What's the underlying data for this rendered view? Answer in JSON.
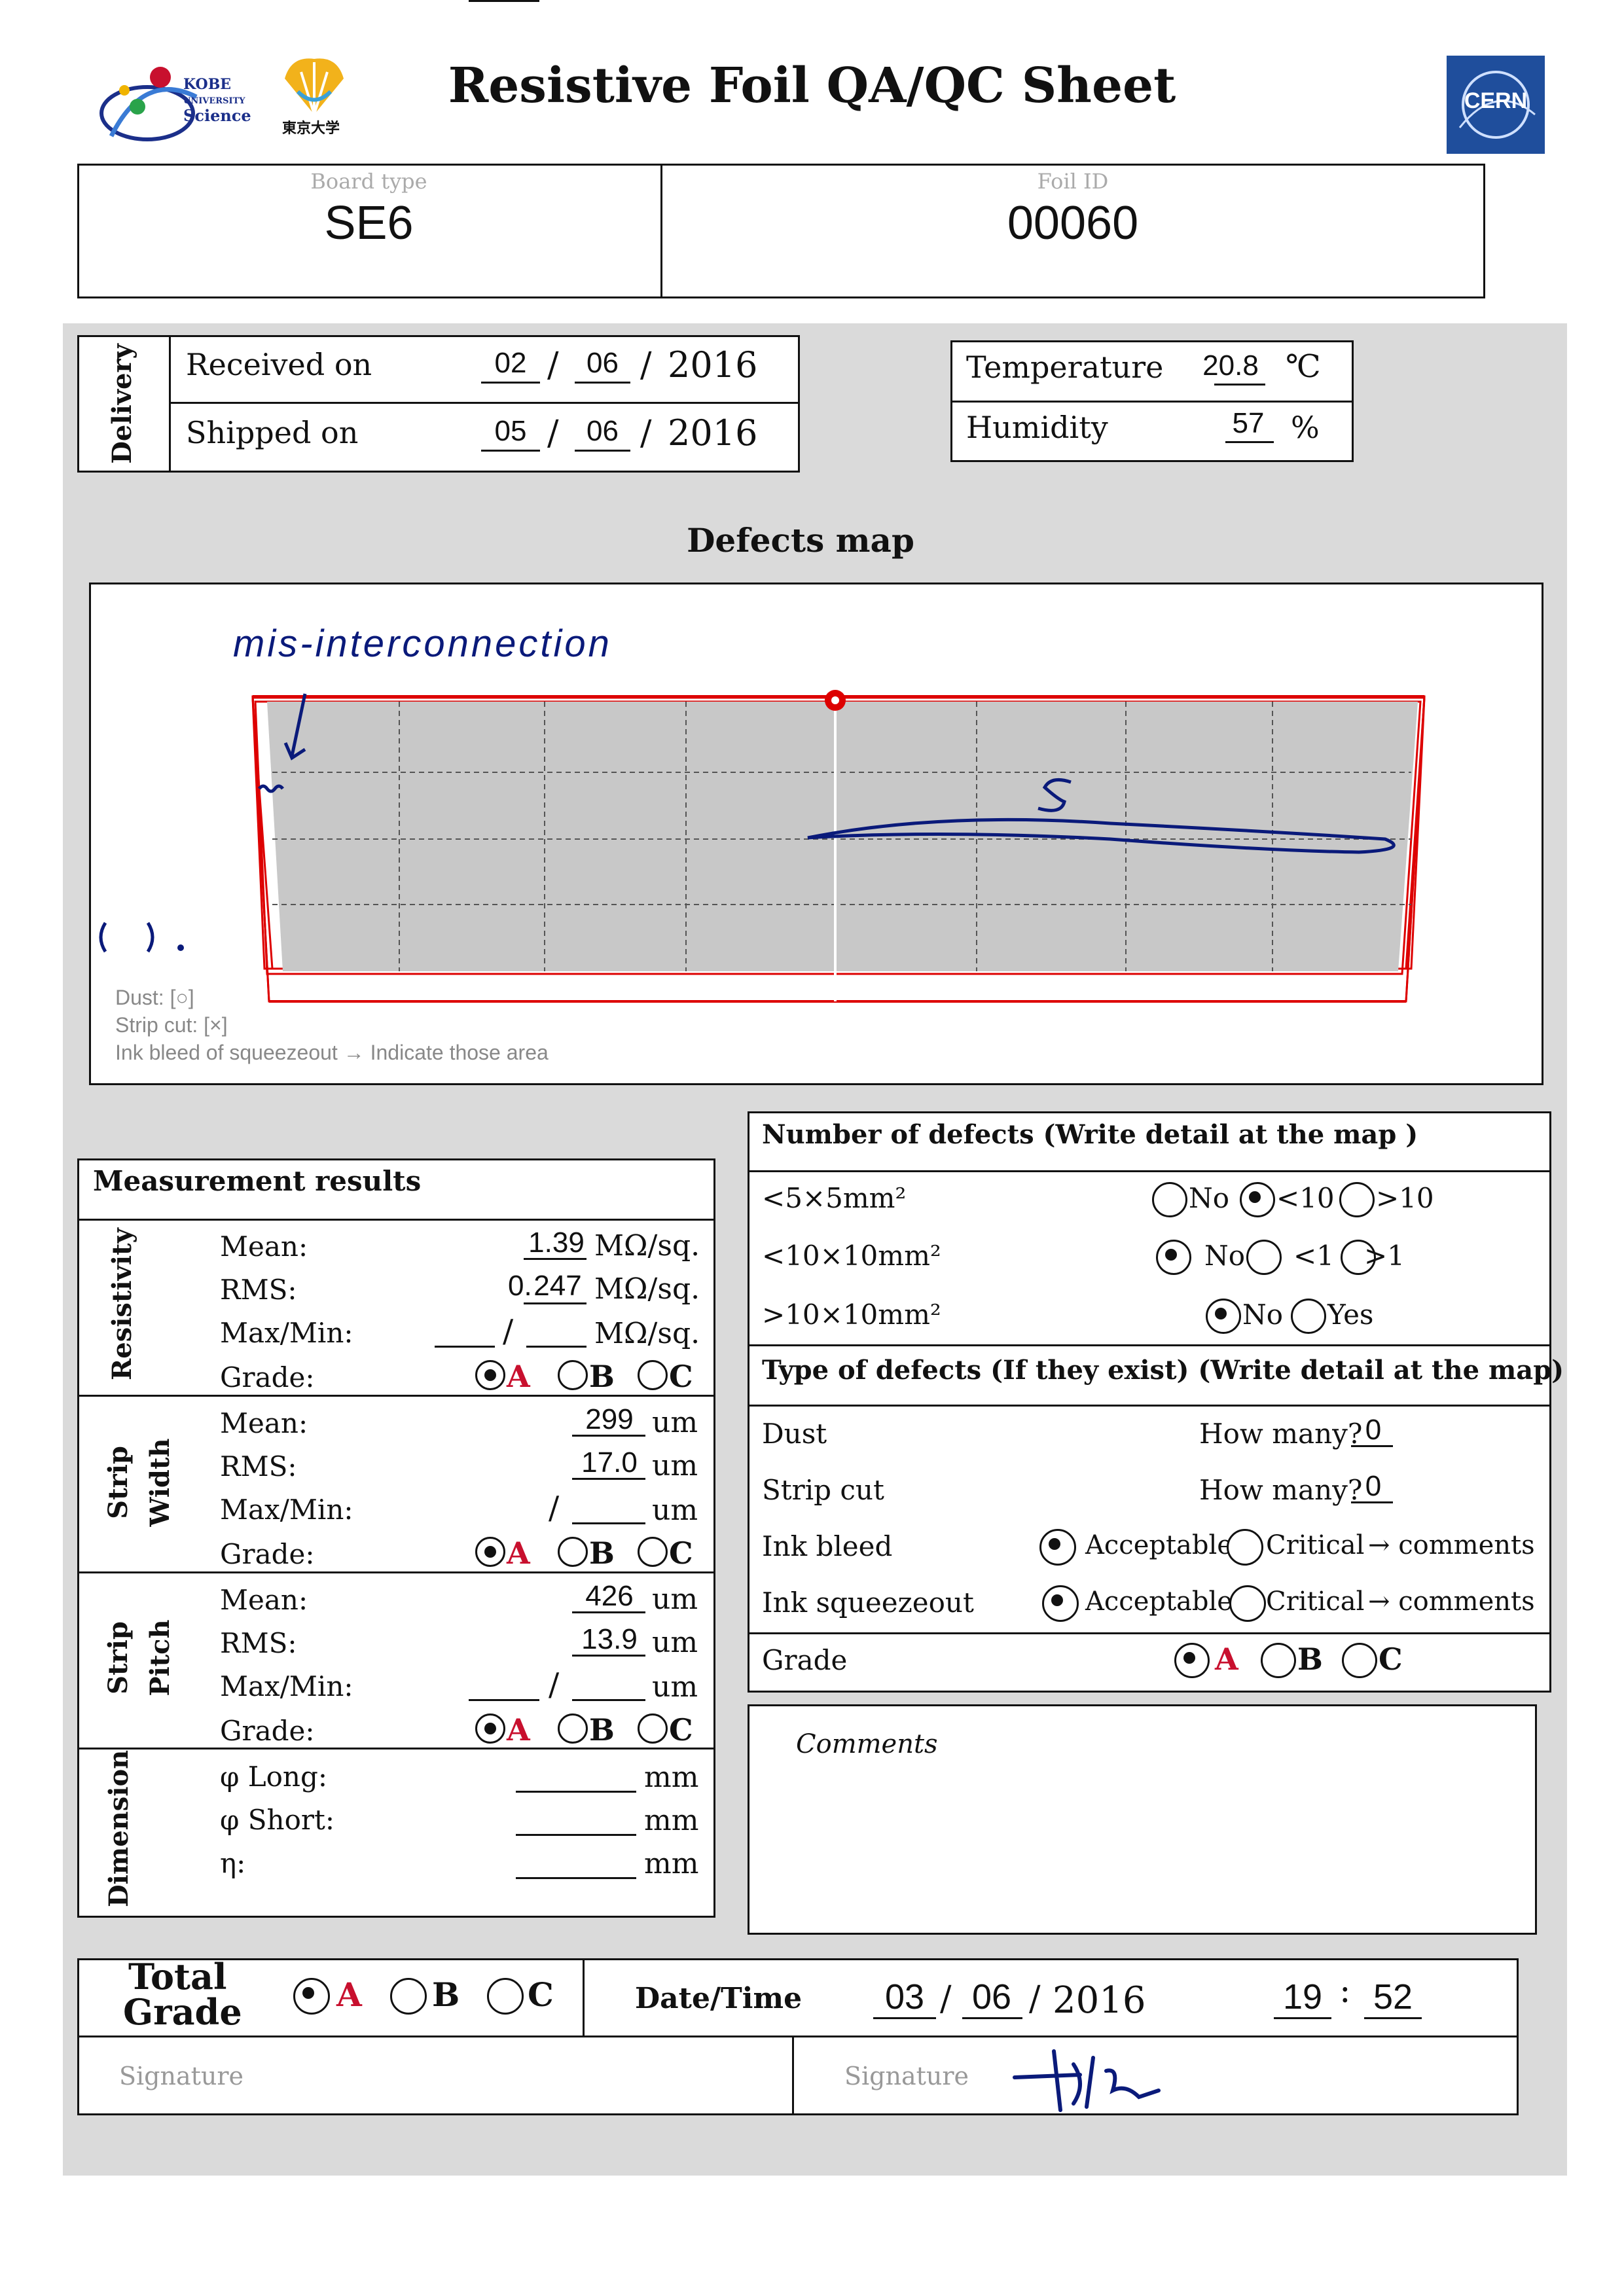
{
  "header": {
    "title": "Resistive Foil QA/QC Sheet",
    "kobe_logo": {
      "line1": "KOBE",
      "line2": "UNIVERSITY",
      "line3": "Science"
    },
    "tokyo_logo": {
      "text": "東京大学"
    },
    "cern_logo": {
      "text": "CERN"
    }
  },
  "ids": {
    "board_type_label": "Board type",
    "board_type_value": "SE6",
    "foil_id_label": "Foil ID",
    "foil_id_value": "00060"
  },
  "delivery": {
    "section_label": "Delivery",
    "received_label": "Received on",
    "received_day": "02",
    "received_month": "06",
    "received_year": "2016",
    "shipped_label": "Shipped on",
    "shipped_day": "05",
    "shipped_month": "06",
    "shipped_year": "2016",
    "slash": "/"
  },
  "environment": {
    "temperature_label": "Temperature",
    "temperature_value": "20.8",
    "temperature_unit": "℃",
    "humidity_label": "Humidity",
    "humidity_value": "57",
    "humidity_unit": "%"
  },
  "defects_map": {
    "title": "Defects map",
    "legend_dust": "Dust: [○]",
    "legend_strip_cut": "Strip cut: [×]",
    "legend_ink": "Ink bleed of squeezeout  →  Indicate those area",
    "annotation_misconnection": "mis-interconnection",
    "annotation_s": "S",
    "annotation_circle": "( ) ."
  },
  "measurement": {
    "title": "Measurement results",
    "resistivity": {
      "label": "Resistivity",
      "mean_label": "Mean:",
      "mean_value": "1.39",
      "mean_unit": "MΩ/sq.",
      "rms_label": "RMS:",
      "rms_prefix": "0.",
      "rms_value": "247",
      "rms_unit": "MΩ/sq.",
      "maxmin_label": "Max/Min:",
      "maxmin_unit": "MΩ/sq.",
      "grade_label": "Grade:",
      "grade_selected": "A"
    },
    "strip_width": {
      "label1": "Strip",
      "label2": "Width",
      "mean_label": "Mean:",
      "mean_value": "299",
      "mean_unit": "um",
      "rms_label": "RMS:",
      "rms_value": "17.0",
      "rms_unit": "um",
      "maxmin_label": "Max/Min:",
      "maxmin_unit": "um",
      "grade_label": "Grade:",
      "grade_selected": "A"
    },
    "strip_pitch": {
      "label1": "Strip",
      "label2": "Pitch",
      "mean_label": "Mean:",
      "mean_value": "426",
      "mean_unit": "um",
      "rms_label": "RMS:",
      "rms_value": "13.9",
      "rms_unit": "um",
      "maxmin_label": "Max/Min:",
      "maxmin_unit": "um",
      "grade_label": "Grade:",
      "grade_selected": "A"
    },
    "dimension": {
      "label": "Dimension",
      "long_label": "φ Long:",
      "long_unit": "mm",
      "short_label": "φ Short:",
      "short_unit": "mm",
      "eta_label": "η:",
      "eta_unit": "mm"
    },
    "grade_options": [
      "A",
      "B",
      "C"
    ]
  },
  "defects_count": {
    "title": "Number of defects (Write detail at the map )",
    "row1_label": "<5×5mm²",
    "row1_options": [
      "No",
      "<10",
      ">10"
    ],
    "row1_selected": "<10",
    "row2_label": "<10×10mm²",
    "row2_options": [
      "No",
      "<1",
      ">1"
    ],
    "row2_selected": "No",
    "row3_label": ">10×10mm²",
    "row3_options": [
      "No",
      "Yes"
    ],
    "row3_selected": "No"
  },
  "defects_type": {
    "title": "Type of defects (If they exist) (Write detail at the map)",
    "dust_label": "Dust",
    "dust_howmany_label": "How many?",
    "dust_count": "0",
    "stripcut_label": "Strip cut",
    "stripcut_howmany_label": "How many?",
    "stripcut_count": "0",
    "inkbleed_label": "Ink bleed",
    "inkbleed_selected": "Acceptable",
    "inksqueeze_label": "Ink squeezeout",
    "inksqueeze_selected": "Acceptable",
    "options": [
      "Acceptable",
      "Critical"
    ],
    "comments_arrow": "→  comments",
    "grade_label": "Grade",
    "grade_selected": "A"
  },
  "comments": {
    "label": "Comments"
  },
  "total": {
    "label1": "Total",
    "label2": "Grade",
    "grade_selected": "A",
    "datetime_label": "Date/Time",
    "day": "03",
    "month": "06",
    "year": "2016",
    "hour": "19",
    "minute": "52",
    "colon": ":",
    "signature_label_left": "Signature",
    "signature_label_right": "Signature"
  }
}
